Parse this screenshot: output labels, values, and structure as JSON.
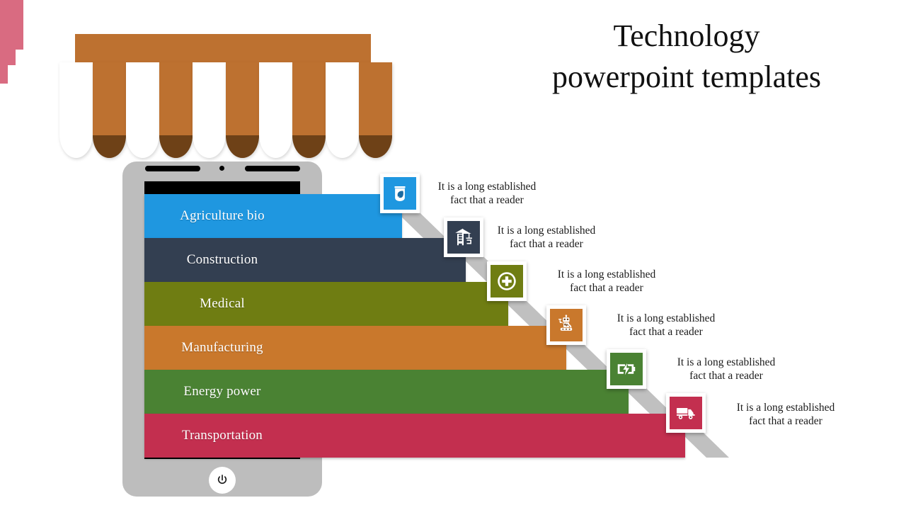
{
  "title": {
    "line1": "Technology",
    "line2": "powerpoint templates"
  },
  "decor": {
    "corner_accent_color": "#d96b81",
    "awning_color": "#bd7130",
    "awning_tip_color": "#6e4117",
    "phone_frame_color": "#bdbdbd",
    "ribbon_shadow_color": "#c0c0c0"
  },
  "rows": [
    {
      "label": "Agriculture bio",
      "color": "#1f97e0",
      "icon": "seed-packet-icon",
      "description_line1": "It is a long established",
      "description_line2": "fact that a reader"
    },
    {
      "label": "Construction",
      "color": "#333f51",
      "icon": "crane-icon",
      "description_line1": "It is a long established",
      "description_line2": "fact that a reader"
    },
    {
      "label": "Medical",
      "color": "#6f7d12",
      "icon": "medical-cross-icon",
      "description_line1": "It is a long established",
      "description_line2": "fact that a reader"
    },
    {
      "label": "Manufacturing",
      "color": "#c9782c",
      "icon": "robot-icon",
      "description_line1": "It is a long established",
      "description_line2": "fact that a reader"
    },
    {
      "label": "Energy power",
      "color": "#4a8233",
      "icon": "battery-charging-icon",
      "description_line1": "It is a long established",
      "description_line2": "fact that a reader"
    },
    {
      "label": "Transportation",
      "color": "#c32f4f",
      "icon": "truck-icon",
      "description_line1": "It is a long established",
      "description_line2": "fact that a reader"
    }
  ],
  "phone": {
    "speaker_left": "speaker-grill-left",
    "speaker_right": "speaker-grill-right",
    "camera": "front-camera-dot",
    "home_button": "power-home-button"
  }
}
